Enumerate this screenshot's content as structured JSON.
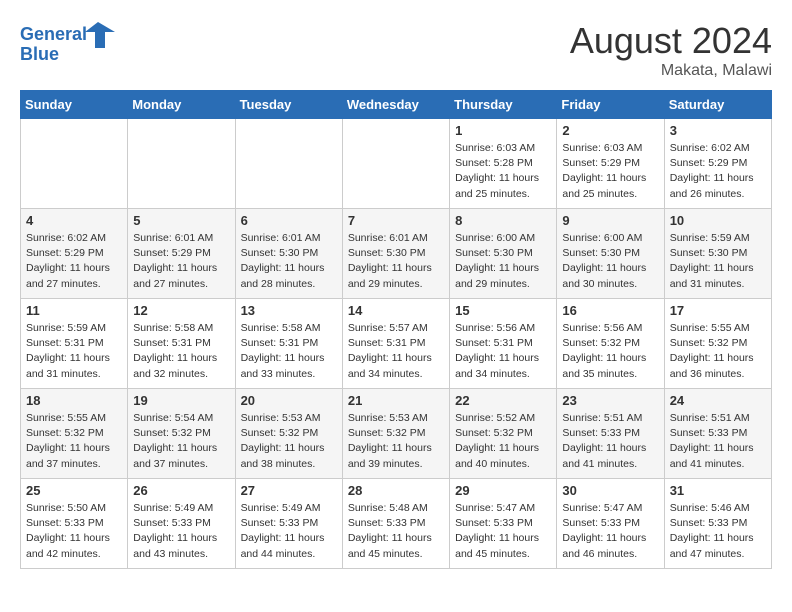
{
  "header": {
    "logo_line1": "General",
    "logo_line2": "Blue",
    "month_year": "August 2024",
    "location": "Makata, Malawi"
  },
  "days_of_week": [
    "Sunday",
    "Monday",
    "Tuesday",
    "Wednesday",
    "Thursday",
    "Friday",
    "Saturday"
  ],
  "weeks": [
    {
      "days": [
        {
          "num": "",
          "info": ""
        },
        {
          "num": "",
          "info": ""
        },
        {
          "num": "",
          "info": ""
        },
        {
          "num": "",
          "info": ""
        },
        {
          "num": "1",
          "info": "Sunrise: 6:03 AM\nSunset: 5:28 PM\nDaylight: 11 hours\nand 25 minutes."
        },
        {
          "num": "2",
          "info": "Sunrise: 6:03 AM\nSunset: 5:29 PM\nDaylight: 11 hours\nand 25 minutes."
        },
        {
          "num": "3",
          "info": "Sunrise: 6:02 AM\nSunset: 5:29 PM\nDaylight: 11 hours\nand 26 minutes."
        }
      ]
    },
    {
      "days": [
        {
          "num": "4",
          "info": "Sunrise: 6:02 AM\nSunset: 5:29 PM\nDaylight: 11 hours\nand 27 minutes."
        },
        {
          "num": "5",
          "info": "Sunrise: 6:01 AM\nSunset: 5:29 PM\nDaylight: 11 hours\nand 27 minutes."
        },
        {
          "num": "6",
          "info": "Sunrise: 6:01 AM\nSunset: 5:30 PM\nDaylight: 11 hours\nand 28 minutes."
        },
        {
          "num": "7",
          "info": "Sunrise: 6:01 AM\nSunset: 5:30 PM\nDaylight: 11 hours\nand 29 minutes."
        },
        {
          "num": "8",
          "info": "Sunrise: 6:00 AM\nSunset: 5:30 PM\nDaylight: 11 hours\nand 29 minutes."
        },
        {
          "num": "9",
          "info": "Sunrise: 6:00 AM\nSunset: 5:30 PM\nDaylight: 11 hours\nand 30 minutes."
        },
        {
          "num": "10",
          "info": "Sunrise: 5:59 AM\nSunset: 5:30 PM\nDaylight: 11 hours\nand 31 minutes."
        }
      ]
    },
    {
      "days": [
        {
          "num": "11",
          "info": "Sunrise: 5:59 AM\nSunset: 5:31 PM\nDaylight: 11 hours\nand 31 minutes."
        },
        {
          "num": "12",
          "info": "Sunrise: 5:58 AM\nSunset: 5:31 PM\nDaylight: 11 hours\nand 32 minutes."
        },
        {
          "num": "13",
          "info": "Sunrise: 5:58 AM\nSunset: 5:31 PM\nDaylight: 11 hours\nand 33 minutes."
        },
        {
          "num": "14",
          "info": "Sunrise: 5:57 AM\nSunset: 5:31 PM\nDaylight: 11 hours\nand 34 minutes."
        },
        {
          "num": "15",
          "info": "Sunrise: 5:56 AM\nSunset: 5:31 PM\nDaylight: 11 hours\nand 34 minutes."
        },
        {
          "num": "16",
          "info": "Sunrise: 5:56 AM\nSunset: 5:32 PM\nDaylight: 11 hours\nand 35 minutes."
        },
        {
          "num": "17",
          "info": "Sunrise: 5:55 AM\nSunset: 5:32 PM\nDaylight: 11 hours\nand 36 minutes."
        }
      ]
    },
    {
      "days": [
        {
          "num": "18",
          "info": "Sunrise: 5:55 AM\nSunset: 5:32 PM\nDaylight: 11 hours\nand 37 minutes."
        },
        {
          "num": "19",
          "info": "Sunrise: 5:54 AM\nSunset: 5:32 PM\nDaylight: 11 hours\nand 37 minutes."
        },
        {
          "num": "20",
          "info": "Sunrise: 5:53 AM\nSunset: 5:32 PM\nDaylight: 11 hours\nand 38 minutes."
        },
        {
          "num": "21",
          "info": "Sunrise: 5:53 AM\nSunset: 5:32 PM\nDaylight: 11 hours\nand 39 minutes."
        },
        {
          "num": "22",
          "info": "Sunrise: 5:52 AM\nSunset: 5:32 PM\nDaylight: 11 hours\nand 40 minutes."
        },
        {
          "num": "23",
          "info": "Sunrise: 5:51 AM\nSunset: 5:33 PM\nDaylight: 11 hours\nand 41 minutes."
        },
        {
          "num": "24",
          "info": "Sunrise: 5:51 AM\nSunset: 5:33 PM\nDaylight: 11 hours\nand 41 minutes."
        }
      ]
    },
    {
      "days": [
        {
          "num": "25",
          "info": "Sunrise: 5:50 AM\nSunset: 5:33 PM\nDaylight: 11 hours\nand 42 minutes."
        },
        {
          "num": "26",
          "info": "Sunrise: 5:49 AM\nSunset: 5:33 PM\nDaylight: 11 hours\nand 43 minutes."
        },
        {
          "num": "27",
          "info": "Sunrise: 5:49 AM\nSunset: 5:33 PM\nDaylight: 11 hours\nand 44 minutes."
        },
        {
          "num": "28",
          "info": "Sunrise: 5:48 AM\nSunset: 5:33 PM\nDaylight: 11 hours\nand 45 minutes."
        },
        {
          "num": "29",
          "info": "Sunrise: 5:47 AM\nSunset: 5:33 PM\nDaylight: 11 hours\nand 45 minutes."
        },
        {
          "num": "30",
          "info": "Sunrise: 5:47 AM\nSunset: 5:33 PM\nDaylight: 11 hours\nand 46 minutes."
        },
        {
          "num": "31",
          "info": "Sunrise: 5:46 AM\nSunset: 5:33 PM\nDaylight: 11 hours\nand 47 minutes."
        }
      ]
    }
  ]
}
